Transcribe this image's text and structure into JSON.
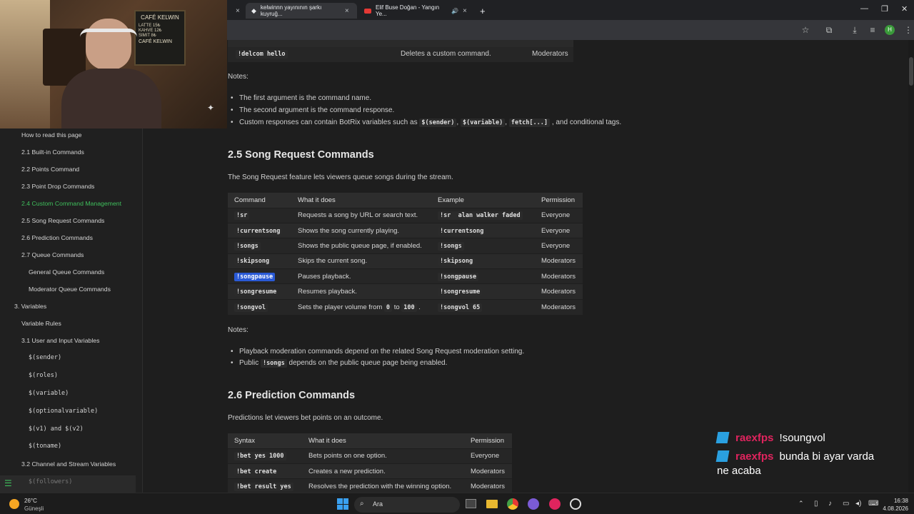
{
  "browser": {
    "tabs": [
      {
        "title": "kelwinnn yayınının şarkı kuyruğ..."
      },
      {
        "title": "Elif Buse Doğan - Yangın Ye..."
      }
    ],
    "new_tab": "+",
    "close": "×",
    "avatar": "H"
  },
  "webcam": {
    "sign_title": "CAFÉ KELWIN",
    "menu": [
      "LATTE 15₺",
      "KAHVE 12₺",
      "SIMIT 8₺"
    ],
    "sign_bottom": "CAFÉ KELWIN"
  },
  "sidebar": {
    "items": [
      {
        "label": "How to read this page",
        "level": 1
      },
      {
        "label": "2.1 Built-in Commands",
        "level": 1
      },
      {
        "label": "2.2 Points Command",
        "level": 1
      },
      {
        "label": "2.3 Point Drop Commands",
        "level": 1
      },
      {
        "label": "2.4 Custom Command Management",
        "level": 1,
        "active": true
      },
      {
        "label": "2.5 Song Request Commands",
        "level": 1
      },
      {
        "label": "2.6 Prediction Commands",
        "level": 1
      },
      {
        "label": "2.7 Queue Commands",
        "level": 1
      },
      {
        "label": "General Queue Commands",
        "level": 2
      },
      {
        "label": "Moderator Queue Commands",
        "level": 2
      },
      {
        "label": "3. Variables",
        "level": 0
      },
      {
        "label": "Variable Rules",
        "level": 1
      },
      {
        "label": "3.1 User and Input Variables",
        "level": 1
      },
      {
        "label": "$(sender)",
        "level": 2,
        "code": true
      },
      {
        "label": "$(roles)",
        "level": 2,
        "code": true
      },
      {
        "label": "$(variable)",
        "level": 2,
        "code": true
      },
      {
        "label": "$(optionalvariable)",
        "level": 2,
        "code": true
      },
      {
        "label": "$(v1) and $(v2)",
        "level": 2,
        "code": true
      },
      {
        "label": "$(toname)",
        "level": 2,
        "code": true
      },
      {
        "label": "3.2 Channel and Stream Variables",
        "level": 1
      },
      {
        "label": "$(followers)",
        "level": 2,
        "code": true
      }
    ]
  },
  "content": {
    "top_row": {
      "command": "!delcom hello",
      "desc": "Deletes a custom command.",
      "perm": "Moderators"
    },
    "notes1_label": "Notes:",
    "notes1": [
      "The first argument is the command name.",
      "The second argument is the command response."
    ],
    "notes1_third": {
      "pre": "Custom responses can contain BotRix variables such as",
      "c1": "$(sender)",
      "sep1": ",",
      "c2": "$(variable)",
      "sep2": ",",
      "c3": "fetch[...]",
      "post": ", and conditional tags."
    },
    "section25": {
      "title": "2.5 Song Request Commands",
      "intro": "The Song Request feature lets viewers queue songs during the stream.",
      "headers": [
        "Command",
        "What it does",
        "Example",
        "Permission"
      ],
      "rows": [
        {
          "cmd": "!sr",
          "desc": "Requests a song by URL or search text.",
          "ex": "!sr  alan walker faded",
          "perm": "Everyone"
        },
        {
          "cmd": "!currentsong",
          "desc": "Shows the song currently playing.",
          "ex": "!currentsong",
          "perm": "Everyone"
        },
        {
          "cmd": "!songs",
          "desc": "Shows the public queue page, if enabled.",
          "ex": "!songs",
          "perm": "Everyone"
        },
        {
          "cmd": "!skipsong",
          "desc": "Skips the current song.",
          "ex": "!skipsong",
          "perm": "Moderators"
        },
        {
          "cmd": "!songpause",
          "desc": "Pauses playback.",
          "ex": "!songpause",
          "perm": "Moderators"
        },
        {
          "cmd": "!songresume",
          "desc": "Resumes playback.",
          "ex": "!songresume",
          "perm": "Moderators"
        },
        {
          "cmd": "!songvol",
          "desc": "Sets the player volume from",
          "desc_c1": "0",
          "desc_mid": "to",
          "desc_c2": "100",
          "desc_end": ".",
          "ex": "!songvol 65",
          "perm": "Moderators"
        }
      ],
      "notes_label": "Notes:",
      "note1": "Playback moderation commands depend on the related Song Request moderation setting.",
      "note2_pre": "Public",
      "note2_code": "!songs",
      "note2_post": "depends on the public queue page being enabled."
    },
    "section26": {
      "title": "2.6 Prediction Commands",
      "intro": "Predictions let viewers bet points on an outcome.",
      "headers": [
        "Syntax",
        "What it does",
        "Permission"
      ],
      "rows": [
        {
          "cmd": "!bet yes 1000",
          "desc": "Bets points on one option.",
          "perm": "Everyone"
        },
        {
          "cmd": "!bet create",
          "desc": "Creates a new prediction.",
          "perm": "Moderators"
        },
        {
          "cmd": "!bet result yes",
          "desc": "Resolves the prediction with the winning option.",
          "perm": "Moderators"
        }
      ]
    }
  },
  "chat": [
    {
      "user": "raexfps",
      "msg": "!soungvol"
    },
    {
      "user": "raexfps",
      "msg": "bunda bi ayar varda"
    },
    {
      "user": "",
      "msg": "ne acaba"
    }
  ],
  "taskbar": {
    "weather_temp": "26°C",
    "weather_desc": "Güneşli",
    "search": "Ara",
    "time": "16:38",
    "date": "4.08.2026"
  },
  "colors": {
    "accent_green": "#3fbf5c",
    "selection": "#2a5ad6",
    "chat_user": "#e0245e"
  }
}
